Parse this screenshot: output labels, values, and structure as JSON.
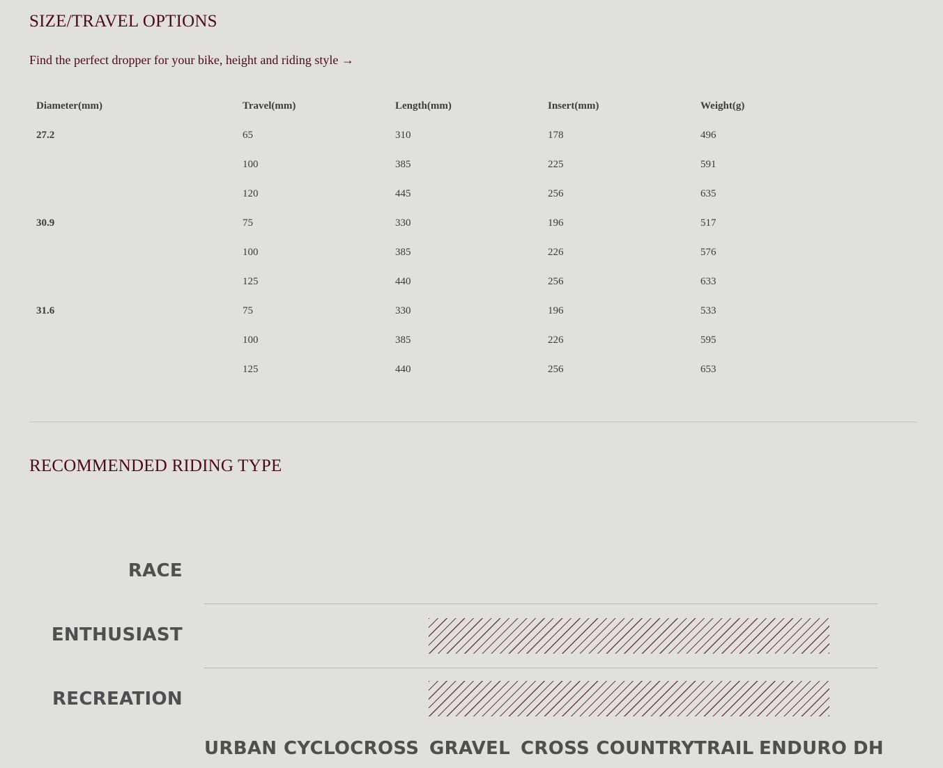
{
  "size_section": {
    "title": "SIZE/TRAVEL OPTIONS",
    "finder_link": "Find the perfect dropper for your bike, height and riding style →",
    "table": {
      "headers": [
        "Diameter(mm)",
        "Travel(mm)",
        "Length(mm)",
        "Insert(mm)",
        "Weight(g)"
      ],
      "rows": [
        [
          "27.2",
          "65",
          "310",
          "178",
          "496"
        ],
        [
          "",
          "100",
          "385",
          "225",
          "591"
        ],
        [
          "",
          "120",
          "445",
          "256",
          "635"
        ],
        [
          "30.9",
          "75",
          "330",
          "196",
          "517"
        ],
        [
          "",
          "100",
          "385",
          "226",
          "576"
        ],
        [
          "",
          "125",
          "440",
          "256",
          "633"
        ],
        [
          "31.6",
          "75",
          "330",
          "196",
          "533"
        ],
        [
          "",
          "100",
          "385",
          "226",
          "595"
        ],
        [
          "",
          "125",
          "440",
          "256",
          "653"
        ]
      ]
    }
  },
  "riding_section": {
    "title": "RECOMMENDED RIDING TYPE",
    "levels": [
      "RACE",
      "ENTHUSIAST",
      "RECREATION"
    ],
    "categories": [
      "URBAN",
      "CYCLOCROSS",
      "GRAVEL",
      "CROSS COUNTRY",
      "TRAIL",
      "ENDURO",
      "DH"
    ],
    "recommended": {
      "RACE": [],
      "ENTHUSIAST": [
        "GRAVEL",
        "CROSS COUNTRY",
        "TRAIL",
        "ENDURO"
      ],
      "RECREATION": [
        "GRAVEL",
        "CROSS COUNTRY",
        "TRAIL",
        "ENDURO"
      ]
    }
  },
  "colors": {
    "background": "#e2e0dd",
    "heading": "#4a0a1b",
    "label": "#4f4f4f",
    "hatch": "#6a3a48"
  }
}
